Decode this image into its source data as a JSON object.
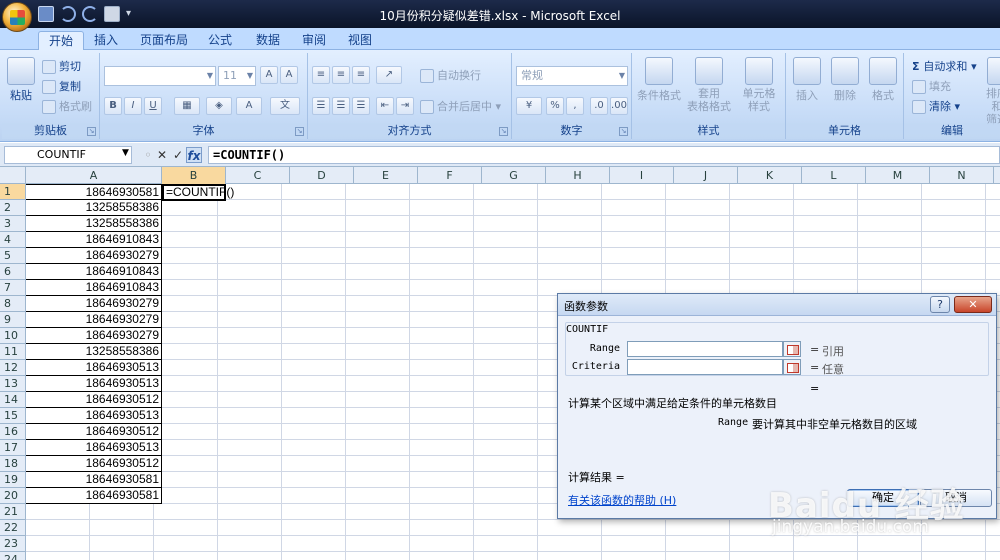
{
  "window": {
    "title": "10月份积分疑似差错.xlsx - Microsoft Excel"
  },
  "ribbon": {
    "tabs": [
      "开始",
      "插入",
      "页面布局",
      "公式",
      "数据",
      "审阅",
      "视图"
    ],
    "active_tab": "开始",
    "clipboard": {
      "paste": "粘贴",
      "cut": "剪切",
      "copy": "复制",
      "format_painter": "格式刷",
      "label": "剪贴板"
    },
    "font": {
      "size": "11",
      "bold": "B",
      "italic": "I",
      "underline": "U",
      "label": "字体"
    },
    "alignment": {
      "wrap_text": "自动换行",
      "merge_center": "合并后居中",
      "label": "对齐方式"
    },
    "number": {
      "format": "常规",
      "percent": "%",
      "comma": ",",
      "label": "数字"
    },
    "styles": {
      "conditional_format": "条件格式",
      "table_format": "套用\n表格格式",
      "cell_styles": "单元格\n样式",
      "label": "样式"
    },
    "cells": {
      "insert": "插入",
      "delete": "删除",
      "format": "格式",
      "label": "单元格"
    },
    "editing": {
      "autosum": "自动求和",
      "fill": "填充",
      "clear": "清除",
      "sort_filter": "排序和\n筛选",
      "label": "编辑"
    }
  },
  "formula_bar": {
    "name_box": "COUNTIF",
    "cancel": "✕",
    "enter": "✓",
    "fx": "fx",
    "formula": "=COUNTIF()"
  },
  "sheet": {
    "columns": [
      "A",
      "B",
      "C",
      "D",
      "E",
      "F",
      "G",
      "H",
      "I",
      "J",
      "K",
      "L",
      "M",
      "N"
    ],
    "rows": [
      "1",
      "2",
      "3",
      "4",
      "5",
      "6",
      "7",
      "8",
      "9",
      "10",
      "11",
      "12",
      "13",
      "14",
      "15",
      "16",
      "17",
      "18",
      "19",
      "20",
      "21",
      "22",
      "23",
      "24"
    ],
    "column_a": [
      "18646930581",
      "13258558386",
      "13258558386",
      "18646910843",
      "18646930279",
      "18646910843",
      "18646910843",
      "18646930279",
      "18646930279",
      "18646930279",
      "13258558386",
      "18646930513",
      "18646930513",
      "18646930512",
      "18646930513",
      "18646930512",
      "18646930513",
      "18646930512",
      "18646930581",
      "18646930581"
    ],
    "b1": "=COUNTIF()"
  },
  "dialog": {
    "title": "函数参数",
    "help_button": "?",
    "close_button": "✕",
    "function_name": "COUNTIF",
    "args": [
      {
        "label": "Range",
        "value": "",
        "eq": "=",
        "hint": "引用"
      },
      {
        "label": "Criteria",
        "value": "",
        "eq": "=",
        "hint": "任意"
      }
    ],
    "eq_result": "=",
    "description": "计算某个区域中满足给定条件的单元格数目",
    "range_label": "Range",
    "range_description": "要计算其中非空单元格数目的区域",
    "result_label": "计算结果 =",
    "help_link": "有关该函数的帮助 (H)",
    "ok": "确定",
    "cancel": "取消"
  },
  "watermark": {
    "logo": "Baidu 经验",
    "url": "jingyan.baidu.com"
  }
}
